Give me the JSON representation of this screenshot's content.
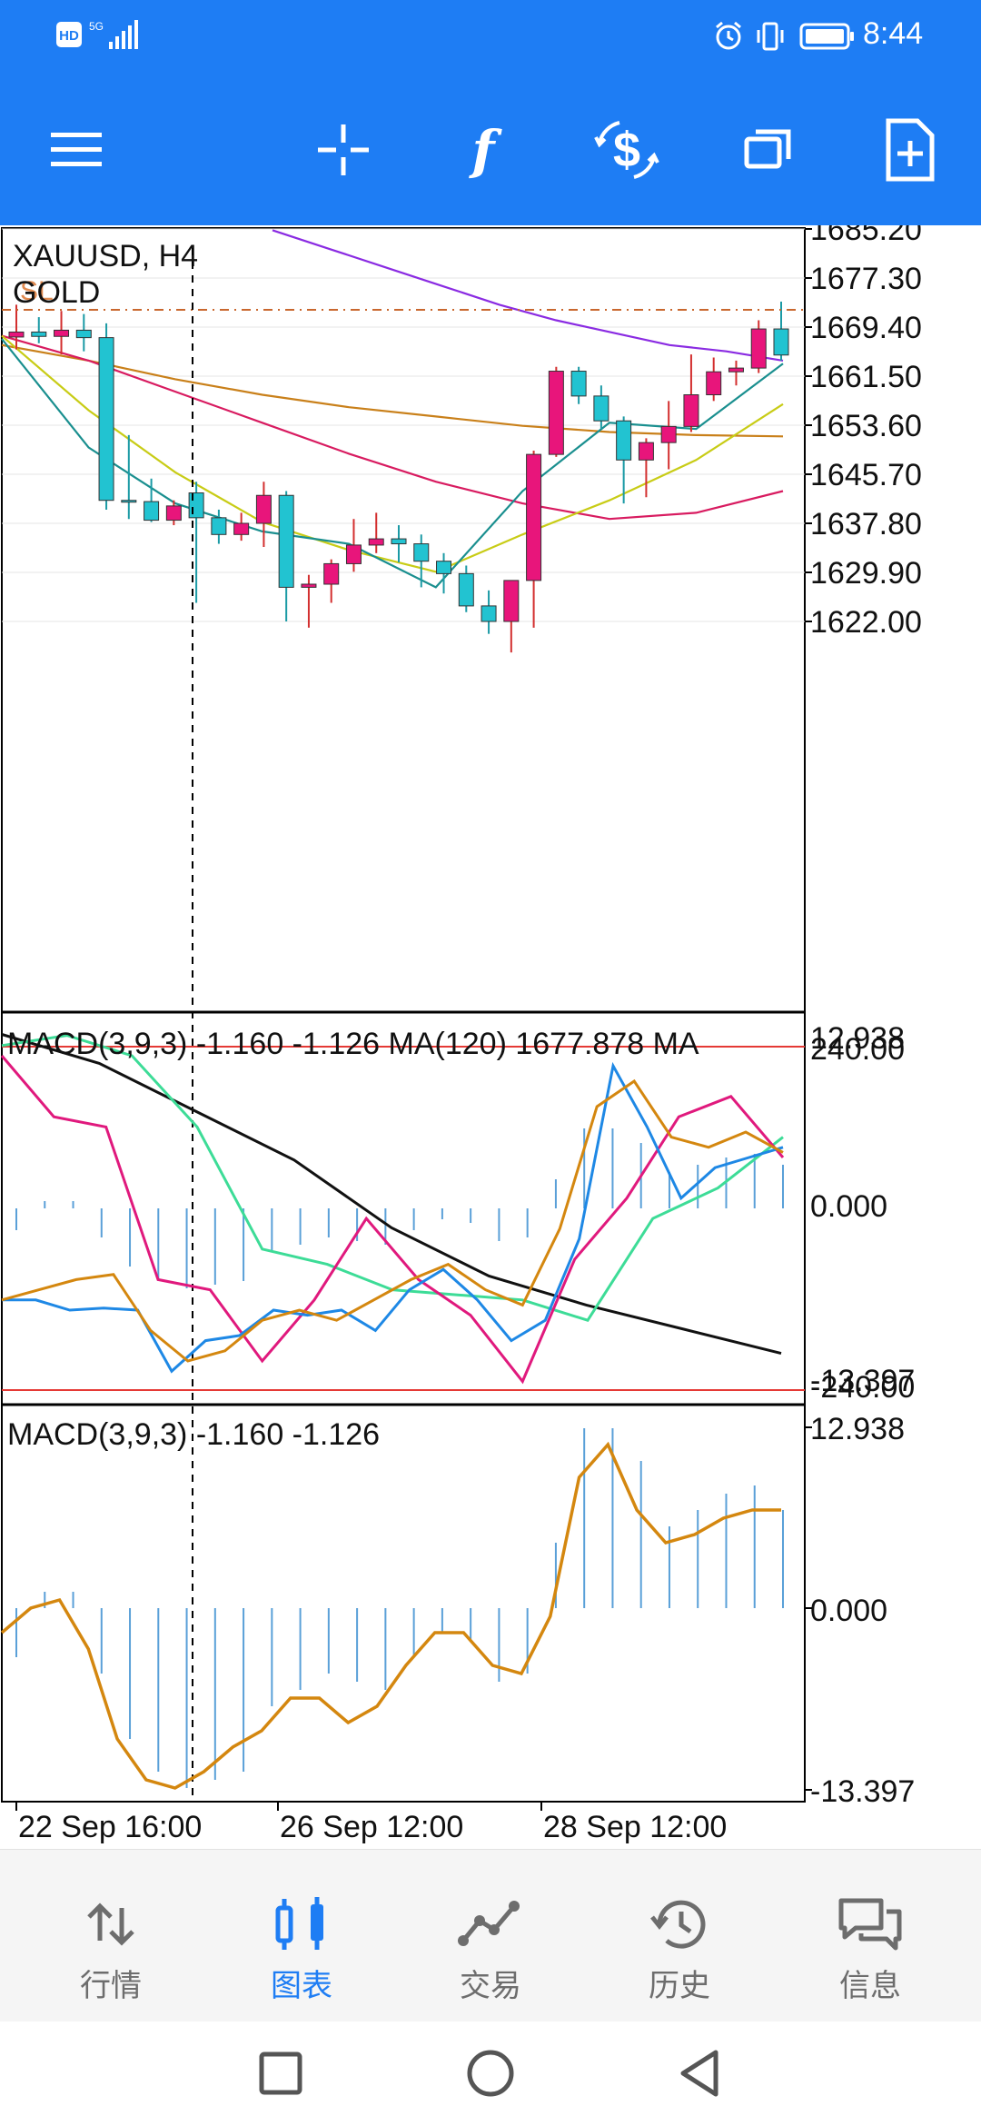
{
  "status_bar": {
    "left_icons": [
      "hd-icon",
      "5g-signal-icon"
    ],
    "right_icons": [
      "alarm-icon",
      "vibrate-icon",
      "battery-icon"
    ],
    "time": "8:44"
  },
  "toolbar": {
    "buttons": [
      "menu-icon",
      "crosshair-icon",
      "indicators-icon",
      "trade-icon",
      "windows-icon",
      "new-order-icon"
    ]
  },
  "chart": {
    "symbol_label": "XAUUSD, H4",
    "description": "GOLD",
    "sl_label": "SL",
    "price_axis": [
      "1685.20",
      "1677.30",
      "1669.40",
      "1661.50",
      "1653.60",
      "1645.70",
      "1637.80",
      "1629.90",
      "1622.00"
    ],
    "macd_ma_pane": {
      "label": "MACD(3,9,3) -1.160 -1.126 MA(120) 1677.878 MA",
      "axis": [
        "12.938",
        "240.00",
        "0.000",
        "-13.397",
        "-240.00"
      ]
    },
    "macd_pane": {
      "label": "MACD(3,9,3) -1.160 -1.126",
      "axis": [
        "12.938",
        "0.000",
        "-13.397"
      ]
    },
    "time_axis": [
      "22 Sep 16:00",
      "26 Sep 12:00",
      "28 Sep 12:00"
    ],
    "colors": {
      "bull": "#e8157b",
      "bear": "#22c3d1",
      "ma_purple": "#8a2be2",
      "ma_orange": "#c9801a",
      "ma_pink": "#d81b60",
      "ma_yellow": "#c8cc16",
      "ma_teal": "#1a8f8f",
      "macd_blue": "#1e88e5",
      "macd_orange": "#d4870f",
      "macd_pink": "#e0197d",
      "macd_green": "#3ddc97",
      "macd_black": "#111111",
      "level_red": "#e53935"
    }
  },
  "chart_data": {
    "type": "candlestick",
    "symbol": "XAUUSD",
    "timeframe": "H4",
    "candles": [
      {
        "o": 1667.8,
        "h": 1673.0,
        "l": 1665.8,
        "c": 1668.6
      },
      {
        "o": 1668.6,
        "h": 1671.0,
        "l": 1666.8,
        "c": 1667.9
      },
      {
        "o": 1667.9,
        "h": 1672.0,
        "l": 1665.0,
        "c": 1668.9
      },
      {
        "o": 1668.9,
        "h": 1671.5,
        "l": 1665.5,
        "c": 1667.7
      },
      {
        "o": 1667.7,
        "h": 1670.0,
        "l": 1640.0,
        "c": 1641.5
      },
      {
        "o": 1641.5,
        "h": 1652.0,
        "l": 1638.5,
        "c": 1641.3
      },
      {
        "o": 1641.3,
        "h": 1645.0,
        "l": 1638.0,
        "c": 1638.3
      },
      {
        "o": 1638.3,
        "h": 1641.5,
        "l": 1637.5,
        "c": 1640.6
      },
      {
        "o": 1642.7,
        "h": 1644.5,
        "l": 1625.0,
        "c": 1638.7
      },
      {
        "o": 1638.7,
        "h": 1640.0,
        "l": 1634.5,
        "c": 1636.0
      },
      {
        "o": 1636.0,
        "h": 1639.5,
        "l": 1635.0,
        "c": 1637.8
      },
      {
        "o": 1637.8,
        "h": 1644.5,
        "l": 1634.0,
        "c": 1642.3
      },
      {
        "o": 1642.3,
        "h": 1643.0,
        "l": 1622.0,
        "c": 1627.5
      },
      {
        "o": 1627.5,
        "h": 1629.5,
        "l": 1621.0,
        "c": 1628.0
      },
      {
        "o": 1628.0,
        "h": 1632.0,
        "l": 1625.0,
        "c": 1631.3
      },
      {
        "o": 1631.3,
        "h": 1638.5,
        "l": 1630.0,
        "c": 1634.3
      },
      {
        "o": 1634.3,
        "h": 1639.5,
        "l": 1633.0,
        "c": 1635.3
      },
      {
        "o": 1635.3,
        "h": 1637.5,
        "l": 1631.5,
        "c": 1634.5
      },
      {
        "o": 1634.5,
        "h": 1636.0,
        "l": 1627.5,
        "c": 1631.7
      },
      {
        "o": 1631.7,
        "h": 1633.0,
        "l": 1626.5,
        "c": 1629.7
      },
      {
        "o": 1629.7,
        "h": 1631.0,
        "l": 1623.5,
        "c": 1624.5
      },
      {
        "o": 1624.5,
        "h": 1627.0,
        "l": 1620.0,
        "c": 1622.0
      },
      {
        "o": 1622.0,
        "h": 1628.5,
        "l": 1617.0,
        "c": 1628.6
      },
      {
        "o": 1628.6,
        "h": 1649.5,
        "l": 1621.0,
        "c": 1648.9
      },
      {
        "o": 1648.9,
        "h": 1663.0,
        "l": 1648.5,
        "c": 1662.3
      },
      {
        "o": 1662.3,
        "h": 1663.0,
        "l": 1657.0,
        "c": 1658.3
      },
      {
        "o": 1658.3,
        "h": 1660.0,
        "l": 1653.0,
        "c": 1654.3
      },
      {
        "o": 1654.3,
        "h": 1655.0,
        "l": 1641.0,
        "c": 1648.0
      },
      {
        "o": 1648.0,
        "h": 1651.5,
        "l": 1642.0,
        "c": 1650.8
      },
      {
        "o": 1650.8,
        "h": 1657.5,
        "l": 1646.5,
        "c": 1653.4
      },
      {
        "o": 1653.4,
        "h": 1665.0,
        "l": 1652.5,
        "c": 1658.5
      },
      {
        "o": 1658.5,
        "h": 1664.5,
        "l": 1657.5,
        "c": 1662.2
      },
      {
        "o": 1662.2,
        "h": 1664.0,
        "l": 1660.0,
        "c": 1662.8
      },
      {
        "o": 1662.8,
        "h": 1670.5,
        "l": 1662.0,
        "c": 1669.1
      },
      {
        "o": 1669.1,
        "h": 1673.5,
        "l": 1664.0,
        "c": 1664.9
      }
    ],
    "sl_level": 1677.3,
    "ma_lines": {
      "purple": [
        1685.0,
        1682.0,
        1679.0,
        1676.0,
        1673.0,
        1670.5,
        1668.5,
        1666.5,
        1665.5,
        1664.0
      ],
      "orange": [
        1666.5,
        1664.0,
        1661.0,
        1658.5,
        1656.5,
        1655.0,
        1653.5,
        1652.5,
        1652.0,
        1651.8
      ],
      "pink": [
        1668.0,
        1664.0,
        1659.0,
        1654.0,
        1649.0,
        1644.5,
        1641.0,
        1638.5,
        1639.5,
        1643.0
      ],
      "yellow": [
        1668.0,
        1656.0,
        1646.0,
        1638.0,
        1633.5,
        1630.0,
        1636.0,
        1641.5,
        1648.0,
        1657.0
      ],
      "teal": [
        1667.5,
        1650.0,
        1641.0,
        1636.5,
        1634.5,
        1627.5,
        1643.0,
        1654.0,
        1653.0,
        1663.5
      ]
    },
    "macd_ma": {
      "ylim": [
        -240,
        240
      ],
      "blue": [
        -0.9,
        -0.9,
        -1.0,
        -0.98,
        -1.0,
        -1.6,
        -1.3,
        -1.25,
        -1.0,
        -1.05,
        -1.0,
        -1.2,
        -0.8,
        -0.6,
        -0.9,
        -1.3,
        -1.1,
        -0.3,
        1.4,
        0.8,
        0.1,
        0.4,
        0.5,
        0.6
      ],
      "orange": [
        -0.9,
        -0.8,
        -0.7,
        -0.65,
        -1.2,
        -1.5,
        -1.4,
        -1.1,
        -1.0,
        -1.1,
        -0.9,
        -0.7,
        -0.55,
        -0.8,
        -0.95,
        -0.2,
        1.0,
        1.25,
        0.7,
        0.6,
        0.75,
        0.55
      ]
    },
    "macd": {
      "values": [
        -0.3,
        0.1,
        0.1,
        -0.4,
        -0.8,
        -1.0,
        -1.1,
        -1.05,
        -1.0,
        -0.6,
        -0.5,
        -0.4,
        -0.45,
        -0.5,
        -0.3,
        -0.15,
        -0.2,
        -0.45,
        -0.4,
        0.4,
        1.1,
        1.1,
        0.9,
        0.5,
        0.6,
        0.7,
        0.75,
        0.6
      ],
      "signal": [
        -0.15,
        0.0,
        0.05,
        -0.25,
        -0.8,
        -1.05,
        -1.1,
        -1.0,
        -0.85,
        -0.75,
        -0.55,
        -0.55,
        -0.7,
        -0.6,
        -0.35,
        -0.15,
        -0.15,
        -0.35,
        -0.4,
        -0.05,
        0.8,
        1.0,
        0.6,
        0.4,
        0.45,
        0.55,
        0.6,
        0.6
      ]
    }
  },
  "bottom_nav": {
    "items": [
      {
        "icon": "quotes-icon",
        "label": "行情"
      },
      {
        "icon": "chart-icon",
        "label": "图表"
      },
      {
        "icon": "trade-icon",
        "label": "交易"
      },
      {
        "icon": "history-icon",
        "label": "历史"
      },
      {
        "icon": "messages-icon",
        "label": "信息"
      }
    ]
  },
  "system_nav": [
    "recents-icon",
    "home-icon",
    "back-icon"
  ]
}
